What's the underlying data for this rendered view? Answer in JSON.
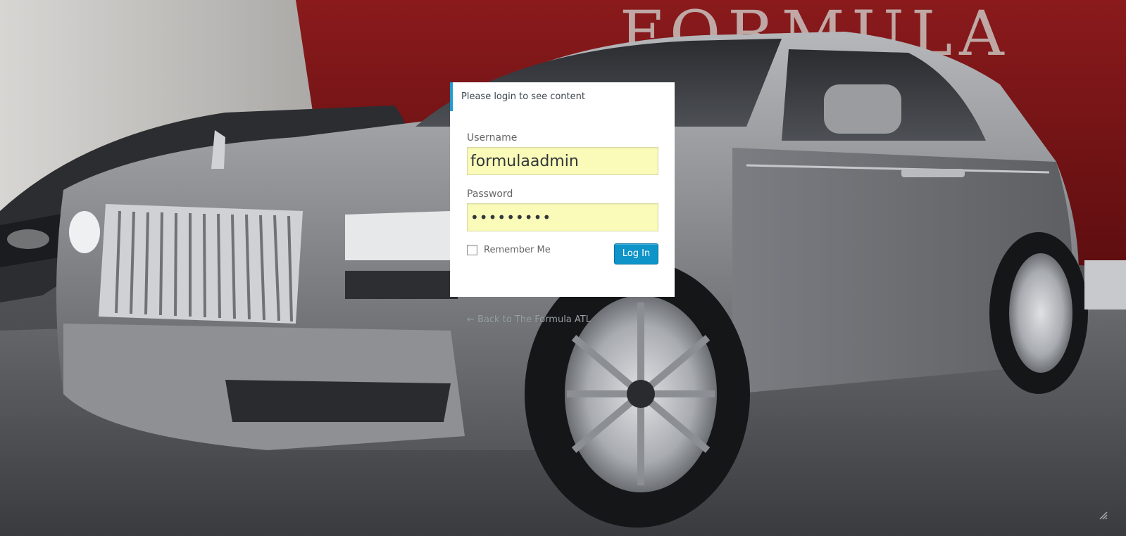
{
  "login": {
    "message": "Please login to see content",
    "username_label": "Username",
    "username_value": "formulaadmin",
    "password_label": "Password",
    "password_display": "•••••••••",
    "remember_label": "Remember Me",
    "remember_checked": false,
    "submit_label": "Log In"
  },
  "nav": {
    "back_link": "← Back to The Formula ATL"
  },
  "background": {
    "sign_text": "FORMULA"
  },
  "colors": {
    "accent": "#1f9bd1",
    "button": "#0e94c8",
    "autofill": "#fbfbb9",
    "wall_red": "#7a1416"
  },
  "icons": {
    "corner": "resize-grip-icon"
  }
}
